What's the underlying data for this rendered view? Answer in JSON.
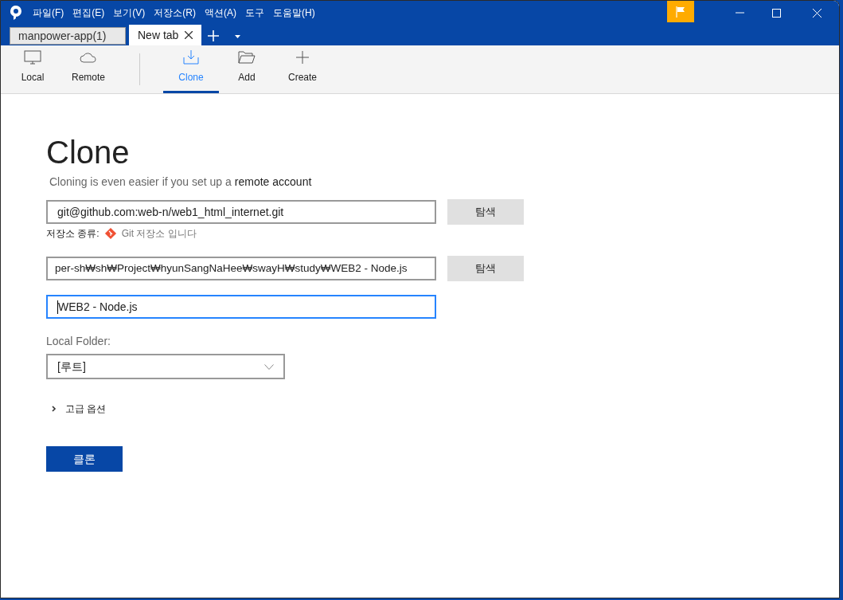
{
  "menu": [
    "파일(F)",
    "편집(E)",
    "보기(V)",
    "저장소(R)",
    "액션(A)",
    "도구",
    "도움말(H)"
  ],
  "tabs": [
    {
      "label": "manpower-app(1)",
      "selected": false
    },
    {
      "label": "New tab",
      "selected": true
    }
  ],
  "toolbar": [
    {
      "label": "Local",
      "selected": false
    },
    {
      "label": "Remote",
      "selected": false
    },
    {
      "label": "Clone",
      "selected": true
    },
    {
      "label": "Add",
      "selected": false
    },
    {
      "label": "Create",
      "selected": false
    }
  ],
  "form": {
    "title": "Clone",
    "subtitle": "Cloning is even easier if you set up a",
    "subtitle_link": "remote account",
    "source": {
      "value": "git@github.com:web-n/web1_html_internet.git",
      "button": "탐색"
    },
    "repo_type": {
      "label": "저장소 종류:",
      "value": "Git 저장소 입니다"
    },
    "destination": {
      "value": "per-sh₩sh₩Project₩hyunSangNaHee₩swayH₩study₩WEB2 - Node.js",
      "button": "탐색"
    },
    "name": {
      "value": "WEB2 - Node.js",
      "focused": true
    },
    "local_folder": {
      "label": "Local Folder:",
      "value": "[루트]"
    },
    "advanced": {
      "label": "고급 옵션",
      "expanded": false
    },
    "clone_button": "클론"
  }
}
